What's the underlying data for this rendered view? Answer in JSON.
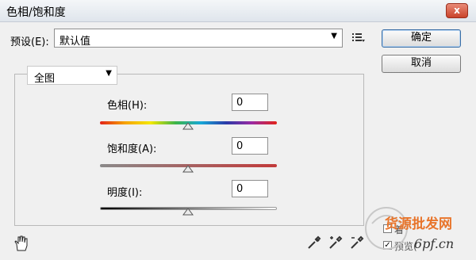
{
  "window": {
    "title": "色相/饱和度",
    "close_glyph": "x"
  },
  "preset": {
    "label": "预设(E):",
    "value": "默认值"
  },
  "buttons": {
    "ok": "确定",
    "cancel": "取消"
  },
  "channel": {
    "value": "全图"
  },
  "sliders": {
    "hue": {
      "label": "色相(H):",
      "value": "0"
    },
    "saturation": {
      "label": "饱和度(A):",
      "value": "0"
    },
    "lightness": {
      "label": "明度(I):",
      "value": "0"
    }
  },
  "options": {
    "colorize_label": "着",
    "preview_label": "预览(",
    "preview_checked": true
  },
  "watermark": {
    "top": "货源批发网",
    "bottom": "6pf.cn"
  },
  "colors": {
    "close": "#c9432b",
    "default_border": "#3a6ea5",
    "watermark": "#e8742a"
  },
  "icons": [
    "close-icon",
    "dropdown-arrow-icon",
    "preset-options-icon",
    "hand-icon",
    "eyedropper-icon",
    "eyedropper-plus-icon",
    "eyedropper-minus-icon",
    "slider-thumb-icon"
  ]
}
